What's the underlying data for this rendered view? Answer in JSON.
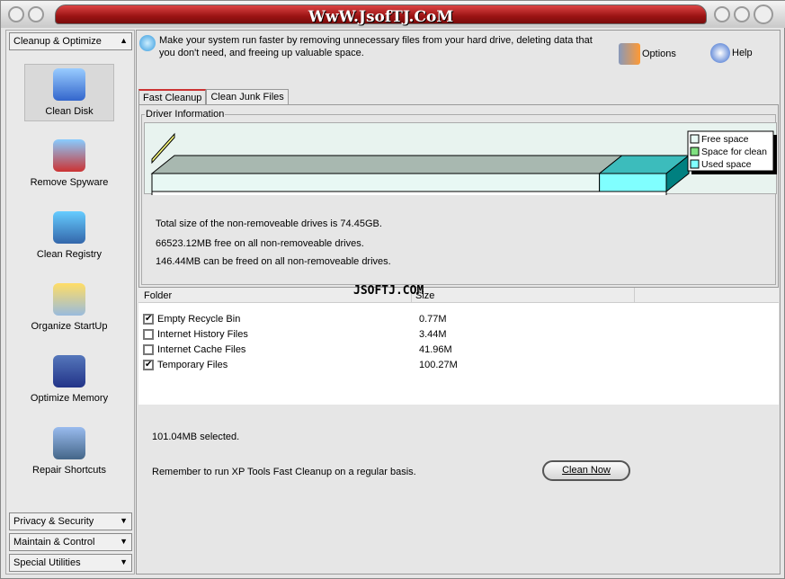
{
  "window": {
    "title": "WwW.JsofTJ.CoM"
  },
  "sidebar": {
    "top_category": "Cleanup & Optimize",
    "tools": [
      {
        "label": "Clean Disk",
        "icon": "clean-disk-icon",
        "selected": true
      },
      {
        "label": "Remove Spyware",
        "icon": "remove-spyware-icon"
      },
      {
        "label": "Clean Registry",
        "icon": "clean-registry-icon"
      },
      {
        "label": "Organize StartUp",
        "icon": "organize-startup-icon"
      },
      {
        "label": "Optimize Memory",
        "icon": "optimize-memory-icon"
      },
      {
        "label": "Repair Shortcuts",
        "icon": "repair-shortcuts-icon"
      }
    ],
    "bottom_categories": [
      "Privacy & Security",
      "Maintain & Control",
      "Special Utilities"
    ]
  },
  "header": {
    "description": "Make your system run faster by removing unnecessary files from your hard drive, deleting data that you don't need, and freeing up valuable space.",
    "options_label": "Options",
    "help_label": "Help"
  },
  "tabs": [
    {
      "label": "Fast Cleanup",
      "active": true
    },
    {
      "label": "Clean Junk Files",
      "active": false
    }
  ],
  "driver_info": {
    "group_label": "Driver Information",
    "lines": [
      "Total size of the non-removeable drives is 74.45GB.",
      "66523.12MB free on all non-removeable drives.",
      "146.44MB can be freed on all non-removeable drives."
    ]
  },
  "chart_data": {
    "type": "bar",
    "orientation": "horizontal-3d-stacked",
    "legend": [
      {
        "name": "Free space",
        "color": "#e8f8f4"
      },
      {
        "name": "Space for clean",
        "color": "#80e080"
      },
      {
        "name": "Used space",
        "color": "#80ffff"
      }
    ],
    "legend_position": "right",
    "shares": {
      "Free space": 0.87,
      "Space for clean": 0.0,
      "Used space": 0.13
    }
  },
  "list": {
    "columns": [
      "Folder",
      "Size"
    ],
    "rows": [
      {
        "name": "Empty Recycle Bin",
        "size": "0.77M",
        "checked": true
      },
      {
        "name": "Internet History Files",
        "size": "3.44M",
        "checked": false
      },
      {
        "name": "Internet Cache Files",
        "size": "41.96M",
        "checked": false
      },
      {
        "name": "Temporary Files",
        "size": "100.27M",
        "checked": true
      }
    ],
    "watermark": "JSOFTJ.COM"
  },
  "footer": {
    "selected": "101.04MB selected.",
    "reminder": "Remember to run XP Tools Fast Cleanup on a regular basis.",
    "clean_button": "Clean Now"
  }
}
